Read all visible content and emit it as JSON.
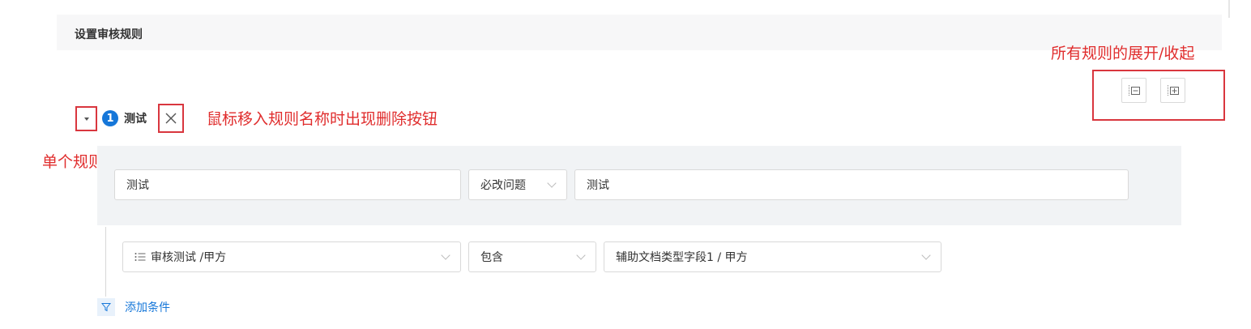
{
  "section": {
    "title": "设置审核规则"
  },
  "annotations": {
    "all_rules": "所有规则的展开/收起",
    "delete_hint": "鼠标移入规则名称时出现删除按钮",
    "single_rule": "单个规则的展开/收起"
  },
  "rule": {
    "index": "1",
    "name": "测试",
    "name_field": "测试",
    "type_select": "必改问题",
    "message_field": "测试"
  },
  "condition": {
    "field_select": "审核测试 /甲方",
    "operator_select": "包含",
    "value_select": "辅助文档类型字段1 / 甲方"
  },
  "add_condition_label": "添加条件",
  "colors": {
    "accent": "#1677d9",
    "annotation": "#e02d2d",
    "panel": "#f1f3f5"
  }
}
